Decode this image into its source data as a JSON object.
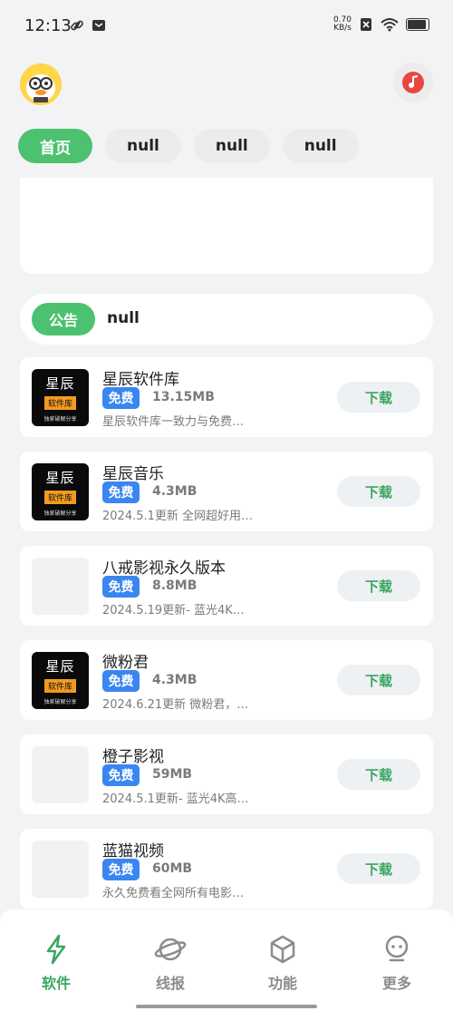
{
  "status_bar": {
    "time": "12:13",
    "net_speed_value": "0.70",
    "net_speed_unit": "KB/s"
  },
  "header": {
    "avatar_icon": "duck-avatar-icon",
    "music_icon": "music-note-icon"
  },
  "tabs": [
    {
      "label": "首页",
      "active": true
    },
    {
      "label": "null",
      "active": false
    },
    {
      "label": "null",
      "active": false
    },
    {
      "label": "null",
      "active": false
    }
  ],
  "notice": {
    "tag": "公告",
    "text": "null"
  },
  "apps": [
    {
      "name": "星辰软件库",
      "badge": "免费",
      "size": "13.15MB",
      "desc": "星辰软件库一致力与免费…",
      "download": "下载",
      "icon": "xingchen-logo"
    },
    {
      "name": "星辰音乐",
      "badge": "免费",
      "size": "4.3MB",
      "desc": "2024.5.1更新 全网超好用…",
      "download": "下载",
      "icon": "xingchen-logo"
    },
    {
      "name": "八戒影视永久版本",
      "badge": "免费",
      "size": "8.8MB",
      "desc": "2024.5.19更新- 蓝光4K…",
      "download": "下载",
      "icon": "placeholder"
    },
    {
      "name": "微粉君",
      "badge": "免费",
      "size": "4.3MB",
      "desc": "2024.6.21更新 微粉君，…",
      "download": "下载",
      "icon": "xingchen-logo"
    },
    {
      "name": "橙子影视",
      "badge": "免费",
      "size": "59MB",
      "desc": "2024.5.1更新- 蓝光4K高…",
      "download": "下载",
      "icon": "placeholder"
    },
    {
      "name": "蓝猫视频",
      "badge": "免费",
      "size": "60MB",
      "desc": "永久免费看全网所有电影…",
      "download": "下载",
      "icon": "placeholder"
    }
  ],
  "logo_text": {
    "top": "星辰",
    "mid": "软件库",
    "bottom": "独家破解分享"
  },
  "bottom_nav": [
    {
      "label": "软件",
      "icon": "lightning-icon",
      "active": true
    },
    {
      "label": "线报",
      "icon": "planet-icon",
      "active": false
    },
    {
      "label": "功能",
      "icon": "cube-icon",
      "active": false
    },
    {
      "label": "更多",
      "icon": "robot-icon",
      "active": false
    }
  ],
  "colors": {
    "accent": "#4cc16f",
    "badge": "#3a86f0",
    "download_text": "#3aa560"
  }
}
